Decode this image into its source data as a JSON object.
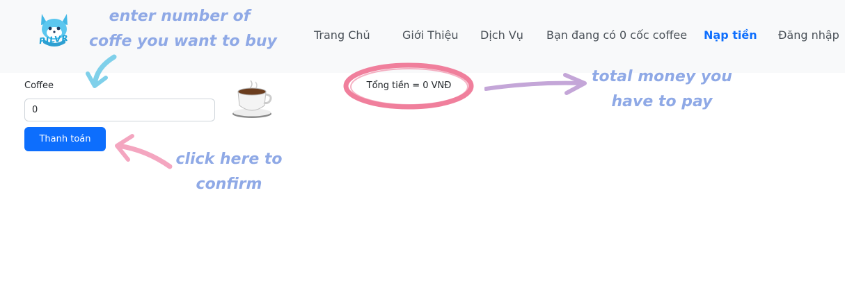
{
  "brand": {
    "logo_text": "PILVR"
  },
  "nav": {
    "items": [
      {
        "label": "Trang Chủ"
      },
      {
        "label": "Giới Thiệu"
      },
      {
        "label": "Dịch Vụ"
      },
      {
        "label": "Bạn đang có 0 cốc coffee"
      },
      {
        "label": "Nạp tiền",
        "active": true
      },
      {
        "label": "Đăng nhập"
      }
    ]
  },
  "form": {
    "label": "Coffee",
    "quantity_value": "0",
    "submit_label": "Thanh toán"
  },
  "total": {
    "text": "Tổng tiền = 0 VNĐ"
  },
  "annotations": {
    "enter_line1": "enter number of",
    "enter_line2": "coffe you want to buy",
    "confirm_line1": "click here to",
    "confirm_line2": "confirm",
    "total_line1": "total money you",
    "total_line2": "have to pay"
  },
  "colors": {
    "primary": "#0d6efd",
    "navbar_bg": "#f8f9fa",
    "annotation_text": "#8fa9e6",
    "circle": "#f07f9c",
    "arrow_blue": "#7fd0ea",
    "arrow_pink": "#f4a6c0",
    "arrow_purple": "#c4a6d8"
  },
  "icons": [
    "fox-logo-icon",
    "coffee-cup-icon"
  ]
}
